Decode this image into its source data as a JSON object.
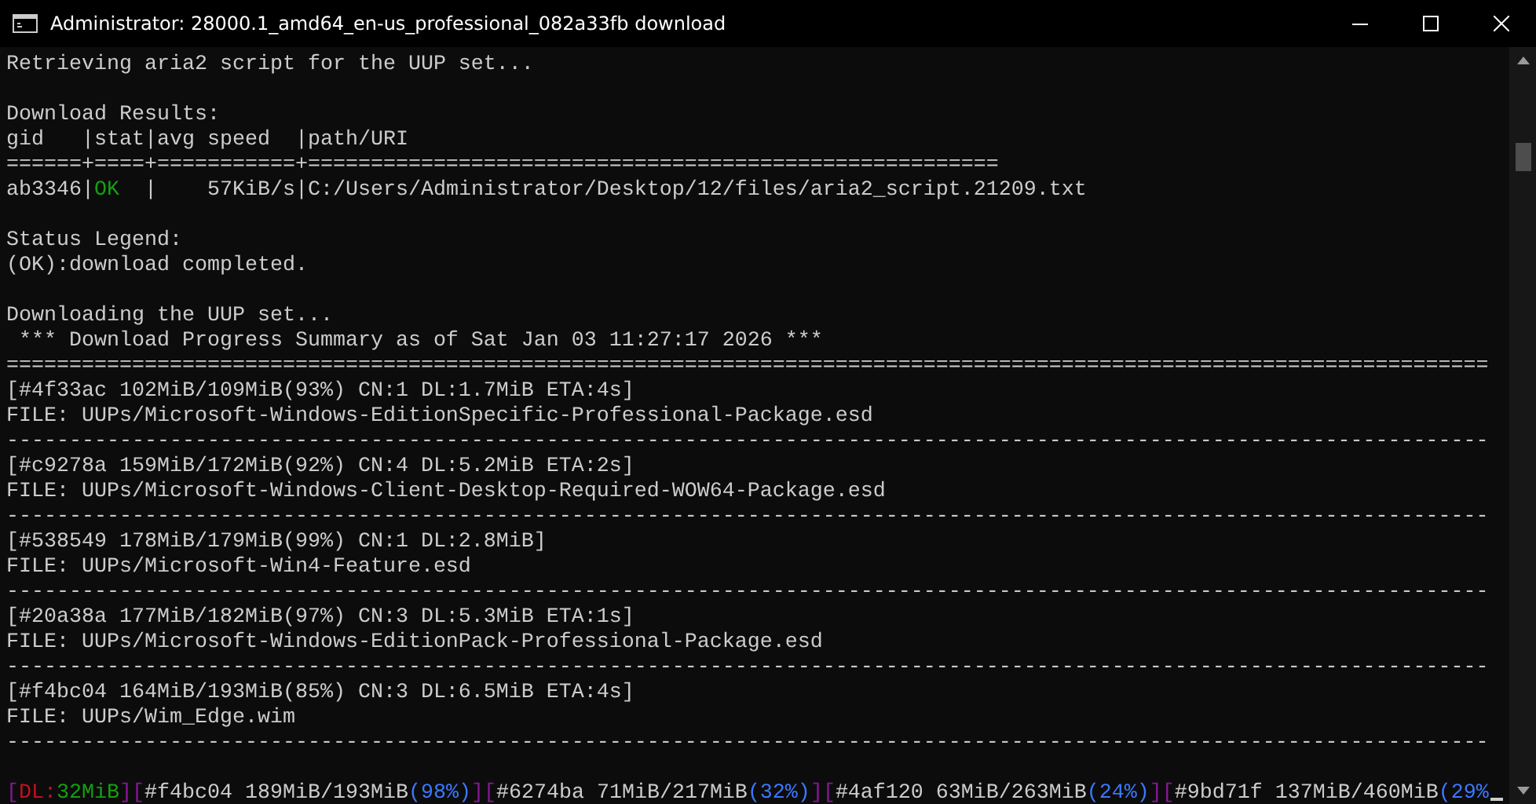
{
  "window": {
    "title": "Administrator:  28000.1_amd64_en-us_professional_082a33fb download"
  },
  "lines": [
    {
      "kind": "text",
      "segments": [
        {
          "text": "Retrieving aria2 script for the UUP set...",
          "kind": "plain"
        }
      ]
    },
    {
      "kind": "blank"
    },
    {
      "kind": "text",
      "segments": [
        {
          "text": "Download Results:",
          "kind": "plain"
        }
      ]
    },
    {
      "kind": "text",
      "segments": [
        {
          "text": "gid   |stat|avg speed  |path/URI",
          "kind": "plain"
        }
      ]
    },
    {
      "kind": "text",
      "segments": [
        {
          "text": "======+====+===========+=======================================================",
          "kind": "plain"
        }
      ]
    },
    {
      "kind": "text",
      "segments": [
        {
          "text": "ab3346|",
          "kind": "plain"
        },
        {
          "text": "OK",
          "kind": "ok"
        },
        {
          "text": "  |    57KiB/s|C:/Users/Administrator/Desktop/12/files/aria2_script.21209.txt",
          "kind": "plain"
        }
      ]
    },
    {
      "kind": "blank"
    },
    {
      "kind": "text",
      "segments": [
        {
          "text": "Status Legend:",
          "kind": "plain"
        }
      ]
    },
    {
      "kind": "text",
      "segments": [
        {
          "text": "(OK):download completed.",
          "kind": "plain"
        }
      ]
    },
    {
      "kind": "blank"
    },
    {
      "kind": "text",
      "segments": [
        {
          "text": "Downloading the UUP set...",
          "kind": "plain"
        }
      ]
    },
    {
      "kind": "text",
      "segments": [
        {
          "text": " *** Download Progress Summary as of Sat Jan 03 11:27:17 2026 ***",
          "kind": "plain"
        }
      ]
    },
    {
      "kind": "text",
      "segments": [
        {
          "text": "======================================================================================================================",
          "kind": "plain"
        }
      ]
    },
    {
      "kind": "text",
      "segments": [
        {
          "text": "[#4f33ac 102MiB/109MiB(93%) CN:1 DL:1.7MiB ETA:4s]",
          "kind": "plain"
        }
      ]
    },
    {
      "kind": "text",
      "segments": [
        {
          "text": "FILE: UUPs/Microsoft-Windows-EditionSpecific-Professional-Package.esd",
          "kind": "plain"
        }
      ]
    },
    {
      "kind": "text",
      "segments": [
        {
          "text": "----------------------------------------------------------------------------------------------------------------------",
          "kind": "plain"
        }
      ]
    },
    {
      "kind": "text",
      "segments": [
        {
          "text": "[#c9278a 159MiB/172MiB(92%) CN:4 DL:5.2MiB ETA:2s]",
          "kind": "plain"
        }
      ]
    },
    {
      "kind": "text",
      "segments": [
        {
          "text": "FILE: UUPs/Microsoft-Windows-Client-Desktop-Required-WOW64-Package.esd",
          "kind": "plain"
        }
      ]
    },
    {
      "kind": "text",
      "segments": [
        {
          "text": "----------------------------------------------------------------------------------------------------------------------",
          "kind": "plain"
        }
      ]
    },
    {
      "kind": "text",
      "segments": [
        {
          "text": "[#538549 178MiB/179MiB(99%) CN:1 DL:2.8MiB]",
          "kind": "plain"
        }
      ]
    },
    {
      "kind": "text",
      "segments": [
        {
          "text": "FILE: UUPs/Microsoft-Win4-Feature.esd",
          "kind": "plain"
        }
      ]
    },
    {
      "kind": "text",
      "segments": [
        {
          "text": "----------------------------------------------------------------------------------------------------------------------",
          "kind": "plain"
        }
      ]
    },
    {
      "kind": "text",
      "segments": [
        {
          "text": "[#20a38a 177MiB/182MiB(97%) CN:3 DL:5.3MiB ETA:1s]",
          "kind": "plain"
        }
      ]
    },
    {
      "kind": "text",
      "segments": [
        {
          "text": "FILE: UUPs/Microsoft-Windows-EditionPack-Professional-Package.esd",
          "kind": "plain"
        }
      ]
    },
    {
      "kind": "text",
      "segments": [
        {
          "text": "----------------------------------------------------------------------------------------------------------------------",
          "kind": "plain"
        }
      ]
    },
    {
      "kind": "text",
      "segments": [
        {
          "text": "[#f4bc04 164MiB/193MiB(85%) CN:3 DL:6.5MiB ETA:4s]",
          "kind": "plain"
        }
      ]
    },
    {
      "kind": "text",
      "segments": [
        {
          "text": "FILE: UUPs/Wim_Edge.wim",
          "kind": "plain"
        }
      ]
    },
    {
      "kind": "text",
      "segments": [
        {
          "text": "----------------------------------------------------------------------------------------------------------------------",
          "kind": "plain"
        }
      ]
    },
    {
      "kind": "blank"
    },
    {
      "kind": "status",
      "cursor": true,
      "segments": [
        {
          "text": "[",
          "kind": "bracket"
        },
        {
          "text": "DL:",
          "kind": "label"
        },
        {
          "text": "32MiB",
          "kind": "ok"
        },
        {
          "text": "]",
          "kind": "bracket"
        },
        {
          "text": "[",
          "kind": "bracket"
        },
        {
          "text": "#f4bc04 189MiB/193MiB",
          "kind": "plain"
        },
        {
          "text": "(98%)",
          "kind": "percent"
        },
        {
          "text": "]",
          "kind": "bracket"
        },
        {
          "text": "[",
          "kind": "bracket"
        },
        {
          "text": "#6274ba 71MiB/217MiB",
          "kind": "plain"
        },
        {
          "text": "(32%)",
          "kind": "percent"
        },
        {
          "text": "]",
          "kind": "bracket"
        },
        {
          "text": "[",
          "kind": "bracket"
        },
        {
          "text": "#4af120 63MiB/263MiB",
          "kind": "plain"
        },
        {
          "text": "(24%)",
          "kind": "percent"
        },
        {
          "text": "]",
          "kind": "bracket"
        },
        {
          "text": "[",
          "kind": "bracket"
        },
        {
          "text": "#9bd71f 137MiB/460MiB",
          "kind": "plain"
        },
        {
          "text": "(29%",
          "kind": "percent"
        }
      ]
    }
  ]
}
